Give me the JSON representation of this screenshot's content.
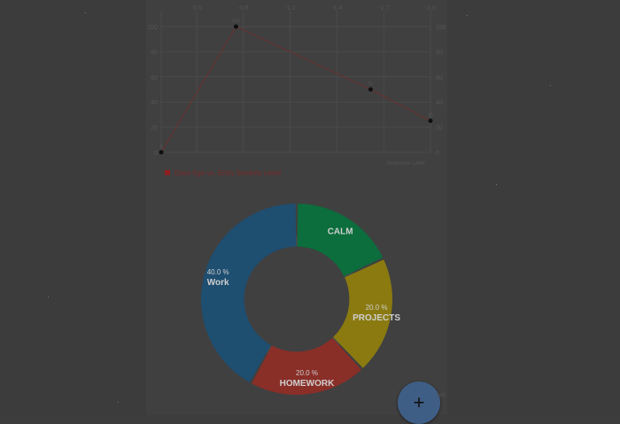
{
  "line_chart": {
    "chart_data": {
      "type": "line",
      "title": "",
      "xlabel": "Sequence Label",
      "ylabel": "",
      "top_ticks": [
        "-0.5",
        "-0.8",
        "-1.1",
        "-1.4",
        "-1.7",
        "-2.0"
      ],
      "top_range": [
        -0.2,
        -2.0
      ],
      "y_ticks": [
        "100",
        "80",
        "60",
        "40",
        "20",
        "0"
      ],
      "ylim": [
        0,
        100
      ],
      "grid": true,
      "legend_position": "bottom-left",
      "series": [
        {
          "name": "Days Ago vs. Entry Severity Level",
          "color": "#8b1f1f",
          "points": [
            {
              "x": -0.2,
              "y": 0,
              "label": "0"
            },
            {
              "x": -0.7,
              "y": 100,
              "label": "100"
            },
            {
              "x": -1.6,
              "y": 50,
              "label": "50"
            },
            {
              "x": -2.0,
              "y": 25,
              "label": "25"
            }
          ]
        }
      ]
    }
  },
  "donut_chart": {
    "chart_data": {
      "type": "pie",
      "hole_fraction": 0.55,
      "slices": [
        {
          "name": "CALM",
          "value_text": "",
          "value": 18.0,
          "color": "#0b6e3c"
        },
        {
          "name": "PROJECTS",
          "value_text": "20.0 %",
          "value": 20.0,
          "color": "#8a7a10"
        },
        {
          "name": "HOMEWORK",
          "value_text": "20.0 %",
          "value": 20.0,
          "color": "#8a2e28"
        },
        {
          "name": "Work",
          "value_text": "40.0 %",
          "value": 42.0,
          "color": "#1e4e70"
        }
      ]
    }
  },
  "fab": {
    "icon": "plus-icon",
    "glyph": "+",
    "label": "Add"
  },
  "colors": {
    "background": "#3c3c3c",
    "content": "#404040",
    "grid": "#4a4a4a"
  }
}
